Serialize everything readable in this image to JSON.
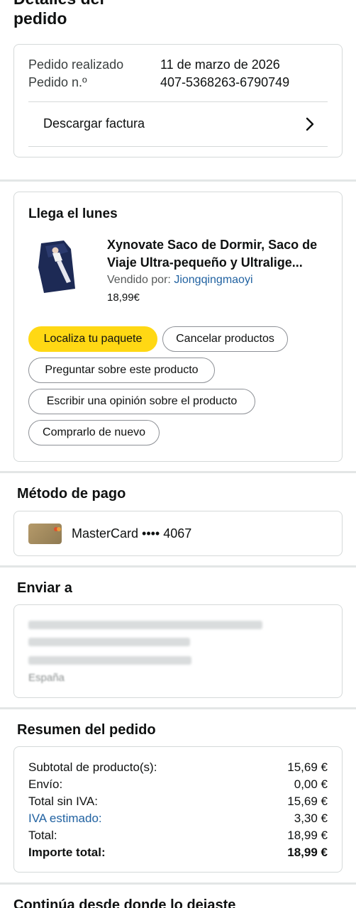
{
  "header": {
    "title_top": "Detalles del",
    "title": "pedido"
  },
  "order_info": {
    "placed_label": "Pedido realizado",
    "placed_value": "11 de marzo de 2026",
    "number_label": "Pedido n.º",
    "number_value": "407-5368263-6790749",
    "invoice_label": "Descargar factura"
  },
  "shipment": {
    "arrival": "Llega el lunes",
    "product_title_line1": "Xynovate Saco de Dormir, Saco de",
    "product_title_line2": "Viaje Ultra-pequeño y Ultralige...",
    "sold_by_label": "Vendido por:",
    "seller": "Jiongqingmaoyi",
    "price": "18,99€",
    "buttons": {
      "track": "Localiza tu paquete",
      "cancel": "Cancelar productos",
      "ask": "Preguntar sobre este producto",
      "review": "Escribir una opinión sobre el producto",
      "buy_again": "Comprarlo de nuevo"
    }
  },
  "payment": {
    "heading": "Método de pago",
    "card_text": "MasterCard •••• 4067"
  },
  "ship_to": {
    "heading": "Enviar a",
    "country": "España"
  },
  "summary": {
    "heading": "Resumen del pedido",
    "rows": [
      {
        "label": "Subtotal de producto(s):",
        "value": "15,69 €"
      },
      {
        "label": "Envío:",
        "value": "0,00 €"
      },
      {
        "label": "Total sin IVA:",
        "value": "15,69 €"
      },
      {
        "label": "IVA estimado:",
        "value": "3,30 €"
      },
      {
        "label": "Total:",
        "value": "18,99 €"
      },
      {
        "label": "Importe total:",
        "value": "18,99 €"
      }
    ]
  },
  "footer": {
    "continue_heading": "Continúa desde donde lo dejaste"
  },
  "colors": {
    "accent_yellow": "#ffd814",
    "link_blue": "#2162a1",
    "separator": "#e3e6e6",
    "border": "#d5d9d9"
  }
}
